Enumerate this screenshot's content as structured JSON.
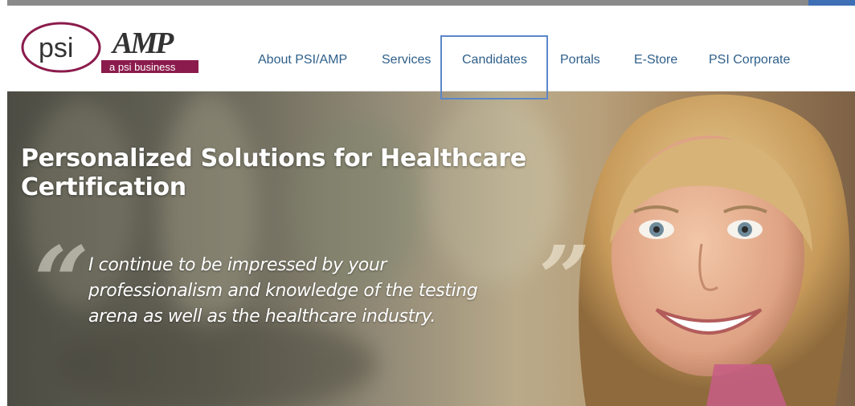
{
  "logo": {
    "psi_text": "psi",
    "amp_text": "AMP",
    "tagline": "a psi business"
  },
  "nav": {
    "items": [
      {
        "label": "About PSI/AMP"
      },
      {
        "label": "Services"
      },
      {
        "label": "Candidates"
      },
      {
        "label": "Portals"
      },
      {
        "label": "E-Store"
      },
      {
        "label": "PSI Corporate"
      }
    ],
    "highlighted": "Candidates"
  },
  "hero": {
    "headline_line1": "Personalized Solutions for Healthcare",
    "headline_line2": "Certification",
    "quote_line1": "I continue to be impressed by your",
    "quote_line2": "professionalism and knowledge of the testing",
    "quote_line3": "arena as well as the healthcare industry."
  },
  "colors": {
    "nav_text": "#2f5f8a",
    "logo_maroon": "#8b1b4c",
    "highlight_border": "#5b86c9"
  }
}
